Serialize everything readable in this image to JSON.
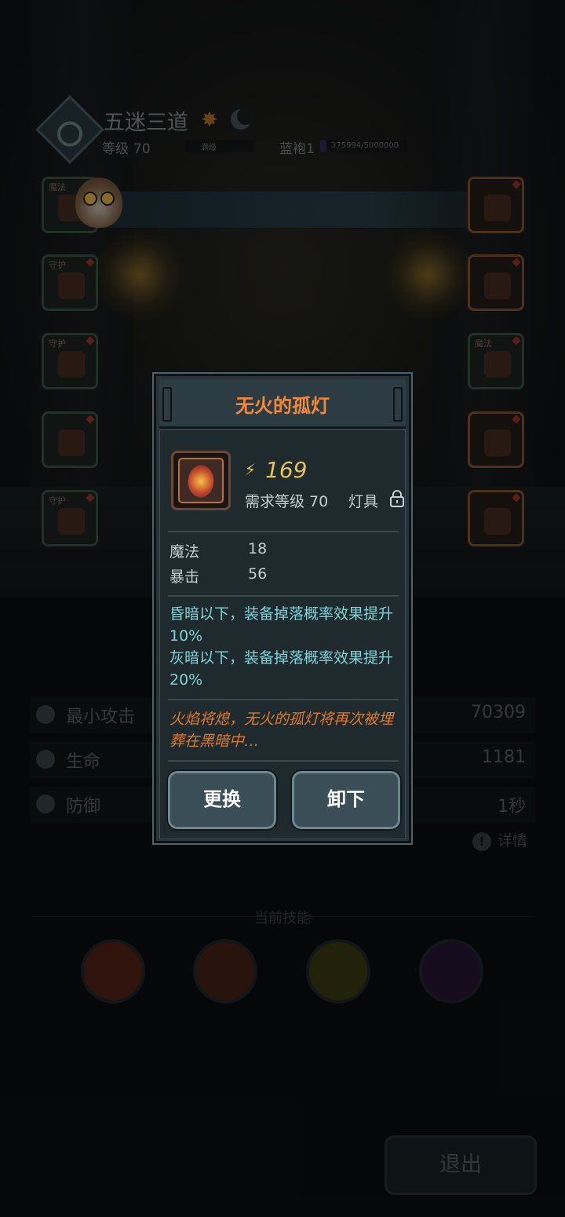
{
  "player": {
    "name": "五迷三道",
    "level_label": "等级",
    "level_value": "70",
    "level_status": "满级",
    "rank_title": "蓝袍1",
    "rank_progress_text": "375994/5000000",
    "rank_progress_fraction": 0.075
  },
  "slots": {
    "left": [
      {
        "tag": "魔法",
        "icon": "weapon-icon"
      },
      {
        "tag": "守护",
        "icon": "armor-icon"
      },
      {
        "tag": "守护",
        "icon": "boots-icon"
      },
      {
        "tag": "",
        "icon": "bracer-icon"
      },
      {
        "tag": "守护",
        "icon": "shoulder-icon"
      }
    ],
    "right": [
      {
        "tag": "",
        "icon": "crossbow-icon"
      },
      {
        "tag": "",
        "icon": "ring-icon"
      },
      {
        "tag": "魔法",
        "icon": "necklace-icon"
      },
      {
        "tag": "",
        "icon": "lamp-icon"
      },
      {
        "tag": "",
        "icon": "mace-icon"
      }
    ]
  },
  "stats": [
    {
      "label": "最小攻击",
      "value": "70309",
      "icon": "attack-icon"
    },
    {
      "label": "生命",
      "value": "1181",
      "icon": "heart-icon"
    },
    {
      "label": "防御",
      "value": "1秒",
      "icon": "shield-icon"
    }
  ],
  "details_label": "详情",
  "skills_title": "当前技能",
  "skills": [
    {
      "icon": "crossed-axes-icon",
      "color": "#7a2a1e"
    },
    {
      "icon": "flame-shield-icon",
      "color": "#6a2a1a"
    },
    {
      "icon": "spheres-icon",
      "color": "#5a5a1a"
    },
    {
      "icon": "shadow-blade-icon",
      "color": "#3a1e4a"
    }
  ],
  "exit_label": "退出",
  "modal": {
    "title": "无火的孤灯",
    "power": "169",
    "requirement": "需求等级 70",
    "item_type": "灯具",
    "attributes": [
      {
        "label": "魔法",
        "value": "18"
      },
      {
        "label": "暴击",
        "value": "56"
      }
    ],
    "effects": [
      "昏暗以下，装备掉落概率效果提升10%",
      "灰暗以下，装备掉落概率效果提升20%"
    ],
    "lore": "火焰将熄，无火的孤灯将再次被埋葬在黑暗中…",
    "replace_label": "更换",
    "unequip_label": "卸下"
  }
}
